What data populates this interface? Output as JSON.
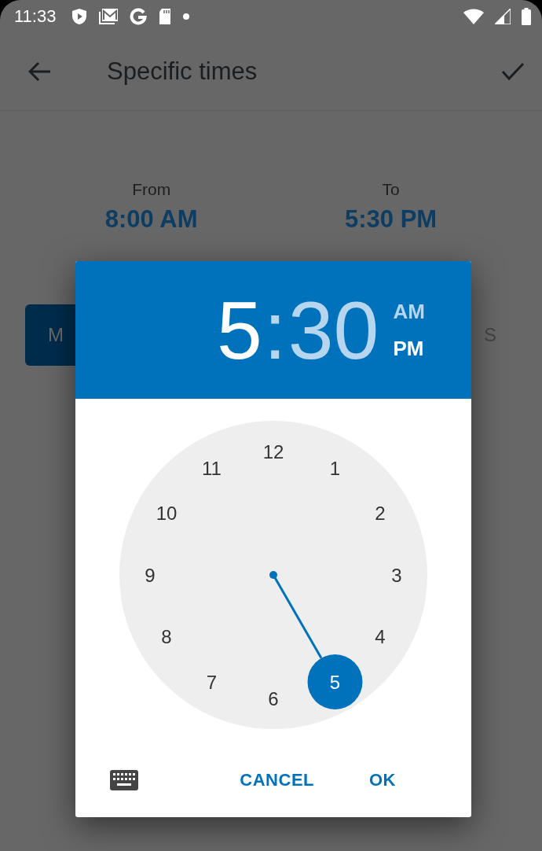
{
  "status_bar": {
    "time": "11:33"
  },
  "toolbar": {
    "title": "Specific times"
  },
  "range": [
    {
      "label": "From",
      "value": "8:00 AM"
    },
    {
      "label": "To",
      "value": "5:30 PM"
    }
  ],
  "days": [
    {
      "label": "M",
      "selected": true
    },
    {
      "label": "S",
      "selected": false
    }
  ],
  "dialog": {
    "hour": {
      "text": "5",
      "selected": true
    },
    "separator": ":",
    "minute": {
      "text": "30",
      "selected": false
    },
    "periods": [
      {
        "label": "AM",
        "selected": false
      },
      {
        "label": "PM",
        "selected": true
      }
    ],
    "dial": [
      {
        "label": "12",
        "selected": false
      },
      {
        "label": "1",
        "selected": false
      },
      {
        "label": "2",
        "selected": false
      },
      {
        "label": "3",
        "selected": false
      },
      {
        "label": "4",
        "selected": false
      },
      {
        "label": "5",
        "selected": true
      },
      {
        "label": "6",
        "selected": false
      },
      {
        "label": "7",
        "selected": false
      },
      {
        "label": "8",
        "selected": false
      },
      {
        "label": "9",
        "selected": false
      },
      {
        "label": "10",
        "selected": false
      },
      {
        "label": "11",
        "selected": false
      }
    ],
    "buttons": [
      "CANCEL",
      "OK"
    ]
  }
}
